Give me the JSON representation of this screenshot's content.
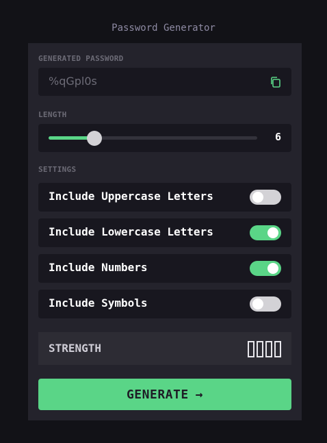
{
  "app": {
    "title": "Password Generator"
  },
  "generated": {
    "label": "GENERATED PASSWORD",
    "value": "%qGpl0s",
    "copy_icon": "copy-icon"
  },
  "length": {
    "label": "LENGTH",
    "value": "6",
    "fraction": 0.22
  },
  "settings": {
    "label": "SETTINGS",
    "options": [
      {
        "label": "Include Uppercase Letters",
        "enabled": false
      },
      {
        "label": "Include Lowercase Letters",
        "enabled": true
      },
      {
        "label": "Include Numbers",
        "enabled": true
      },
      {
        "label": "Include Symbols",
        "enabled": false
      }
    ]
  },
  "strength": {
    "label": "STRENGTH",
    "bars_filled": 0,
    "bars_total": 4
  },
  "generate": {
    "label": "GENERATE",
    "icon": "arrow-right-icon"
  },
  "colors": {
    "accent": "#5ad587",
    "background": "#121217",
    "card": "#24232c",
    "field": "#18171f"
  }
}
